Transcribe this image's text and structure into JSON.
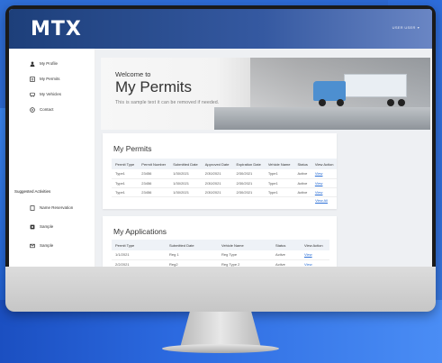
{
  "app": {
    "logo": "MTX",
    "user_label": "USER USER"
  },
  "sidebar": {
    "items": [
      {
        "label": "My Profile",
        "icon": "user-icon"
      },
      {
        "label": "My Permits",
        "icon": "permit-icon"
      },
      {
        "label": "My Vehicles",
        "icon": "vehicle-icon"
      },
      {
        "label": "Contact",
        "icon": "contact-icon"
      }
    ],
    "suggested_title": "Suggested Activities",
    "suggested": [
      {
        "label": "Name Reservation",
        "icon": "document-icon"
      },
      {
        "label": "Sample",
        "icon": "gear-icon"
      },
      {
        "label": "Sample",
        "icon": "mail-icon"
      }
    ]
  },
  "hero": {
    "welcome": "Welcome to",
    "title": "My Permits",
    "description": "This is sample text it can be removed if needed."
  },
  "permits": {
    "title": "My Permits",
    "columns": [
      "Permit Type",
      "Permit Number",
      "Submitted Date",
      "Approved Date",
      "Expiration Date",
      "Vehicle Name",
      "Status",
      "View Action"
    ],
    "rows": [
      [
        "Type1",
        "23456",
        "1/30/2021",
        "2/30/2021",
        "2/30/2021",
        "Type1",
        "Active",
        "View"
      ],
      [
        "Type1",
        "23456",
        "1/30/2021",
        "2/30/2021",
        "2/30/2021",
        "Type1",
        "Active",
        "View"
      ],
      [
        "Type1",
        "23456",
        "1/30/2021",
        "2/30/2021",
        "2/30/2021",
        "Type1",
        "Active",
        "View"
      ]
    ],
    "view_all": "View All"
  },
  "applications": {
    "title": "My Applications",
    "columns": [
      "Permit Type",
      "Submitted Date",
      "Vehicle Name",
      "Status",
      "View Action"
    ],
    "rows": [
      [
        "1/1/2021",
        "Reg 1",
        "Reg Type",
        "Active",
        "View"
      ],
      [
        "2/2/2021",
        "Reg2",
        "Reg Type 2",
        "Active",
        "View"
      ]
    ]
  }
}
